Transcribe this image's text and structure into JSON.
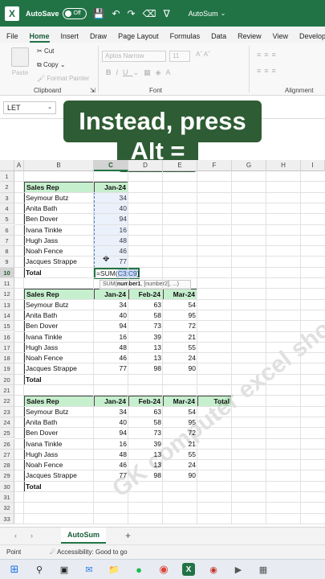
{
  "titlebar": {
    "autosave_label": "AutoSave",
    "autosave_state": "Off",
    "workbook_name": "AutoSum"
  },
  "menu": [
    "File",
    "Home",
    "Insert",
    "Draw",
    "Page Layout",
    "Formulas",
    "Data",
    "Review",
    "View",
    "Develope"
  ],
  "menu_active": "Home",
  "ribbon": {
    "paste": "Paste",
    "cut": "Cut",
    "copy": "Copy",
    "format_painter": "Format Painter",
    "clipboard_label": "Clipboard",
    "font_name": "Aptos Narrow",
    "font_size": "11",
    "font_label": "Font",
    "alignment_label": "Alignment"
  },
  "namebox": "LET",
  "caption": {
    "line1": "Instead, press",
    "line2": "Alt ="
  },
  "columns": [
    "A",
    "B",
    "C",
    "D",
    "E",
    "F",
    "G",
    "H",
    "I"
  ],
  "rows": [
    "1",
    "2",
    "3",
    "4",
    "5",
    "6",
    "7",
    "8",
    "9",
    "10",
    "11",
    "12",
    "13",
    "14",
    "15",
    "16",
    "17",
    "18",
    "19",
    "20",
    "21",
    "22",
    "23",
    "24",
    "25",
    "26",
    "27",
    "28",
    "29",
    "30",
    "31",
    "32",
    "33"
  ],
  "table1": {
    "header": [
      "Sales Rep",
      "Jan-24"
    ],
    "rows": [
      [
        "Seymour Butz",
        "34"
      ],
      [
        "Anita Bath",
        "40"
      ],
      [
        "Ben Dover",
        "94"
      ],
      [
        "Ivana Tinkle",
        "16"
      ],
      [
        "Hugh Jass",
        "48"
      ],
      [
        "Noah Fence",
        "46"
      ],
      [
        "Jacques Strappe",
        "77"
      ]
    ],
    "total_label": "Total",
    "formula_prefix": "=SUM(",
    "formula_ref": "C3:C9",
    "formula_suffix": ")"
  },
  "tooltip": {
    "fn": "SUM(",
    "arg1": "number1",
    "rest": ", [number2], ...)"
  },
  "table2": {
    "header": [
      "Sales Rep",
      "Jan-24",
      "Feb-24",
      "Mar-24"
    ],
    "rows": [
      [
        "Seymour Butz",
        "34",
        "63",
        "54"
      ],
      [
        "Anita Bath",
        "40",
        "58",
        "95"
      ],
      [
        "Ben Dover",
        "94",
        "73",
        "72"
      ],
      [
        "Ivana Tinkle",
        "16",
        "39",
        "21"
      ],
      [
        "Hugh Jass",
        "48",
        "13",
        "55"
      ],
      [
        "Noah Fence",
        "46",
        "13",
        "24"
      ],
      [
        "Jacques Strappe",
        "77",
        "98",
        "90"
      ]
    ],
    "total_label": "Total"
  },
  "table3": {
    "header": [
      "Sales Rep",
      "Jan-24",
      "Feb-24",
      "Mar-24",
      "Total"
    ],
    "rows": [
      [
        "Seymour Butz",
        "34",
        "63",
        "54"
      ],
      [
        "Anita Bath",
        "40",
        "58",
        "95"
      ],
      [
        "Ben Dover",
        "94",
        "73",
        "72"
      ],
      [
        "Ivana Tinkle",
        "16",
        "39",
        "21"
      ],
      [
        "Hugh Jass",
        "48",
        "13",
        "55"
      ],
      [
        "Noah Fence",
        "46",
        "13",
        "24"
      ],
      [
        "Jacques Strappe",
        "77",
        "98",
        "90"
      ]
    ],
    "total_label": "Total"
  },
  "watermark": "GK computer excel short",
  "sheet_tab": "AutoSum",
  "status": {
    "mode": "Point",
    "accessibility": "Accessibility: Good to go"
  },
  "colors": {
    "excel_green": "#217346",
    "header_fill": "#c6efce",
    "caption_bg": "#2e5c34"
  }
}
